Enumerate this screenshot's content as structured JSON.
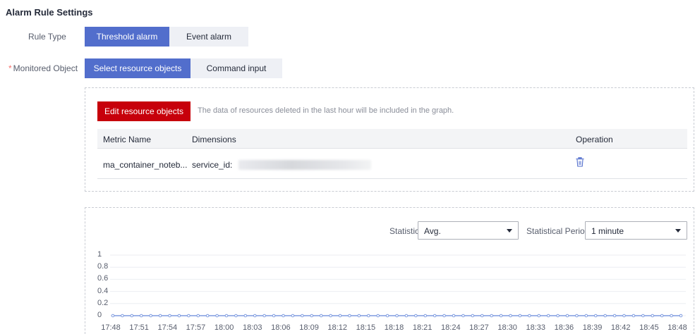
{
  "section": {
    "title": "Alarm Rule Settings"
  },
  "rule_type": {
    "label": "Rule Type",
    "options": [
      "Threshold alarm",
      "Event alarm"
    ],
    "selected": "Threshold alarm"
  },
  "monitored_object": {
    "required_mark": "*",
    "label": "Monitored Object",
    "options": [
      "Select resource objects",
      "Command input"
    ],
    "selected": "Select resource objects"
  },
  "resources": {
    "edit_button": "Edit resource objects",
    "hint": "The data of resources deleted in the last hour will be included in the graph.",
    "table": {
      "headers": [
        "Metric Name",
        "Dimensions",
        "Operation"
      ],
      "rows": [
        {
          "metric": "ma_container_noteb...",
          "dimension": "service_id:"
        }
      ]
    },
    "colors": {
      "edit_button": "#c7000b",
      "delete_icon": "#526ecc"
    },
    "icons": {
      "operation": "delete-icon"
    }
  },
  "graph": {
    "statistic_label": "Statistic",
    "statistic_value": "Avg.",
    "period_label": "Statistical Period",
    "period_value": "1 minute"
  },
  "chart_data": {
    "type": "line",
    "x": [
      "17:48",
      "17:51",
      "17:54",
      "17:57",
      "18:00",
      "18:03",
      "18:06",
      "18:09",
      "18:12",
      "18:15",
      "18:18",
      "18:21",
      "18:24",
      "18:27",
      "18:30",
      "18:33",
      "18:36",
      "18:39",
      "18:42",
      "18:45",
      "18:48"
    ],
    "y_ticks": [
      "1",
      "0.8",
      "0.6",
      "0.4",
      "0.2",
      "0"
    ],
    "ylim": [
      0,
      1
    ],
    "series": [
      {
        "values": [
          0,
          0,
          0,
          0,
          0,
          0,
          0,
          0,
          0,
          0,
          0,
          0,
          0,
          0,
          0,
          0,
          0,
          0,
          0,
          0,
          0,
          0,
          0,
          0,
          0,
          0,
          0,
          0,
          0,
          0,
          0,
          0,
          0,
          0,
          0,
          0,
          0,
          0,
          0,
          0,
          0,
          0,
          0,
          0,
          0,
          0,
          0,
          0,
          0,
          0,
          0,
          0,
          0,
          0,
          0,
          0,
          0,
          0,
          0,
          0,
          0
        ]
      }
    ],
    "grid": true,
    "line_color": "#7e9be0"
  }
}
